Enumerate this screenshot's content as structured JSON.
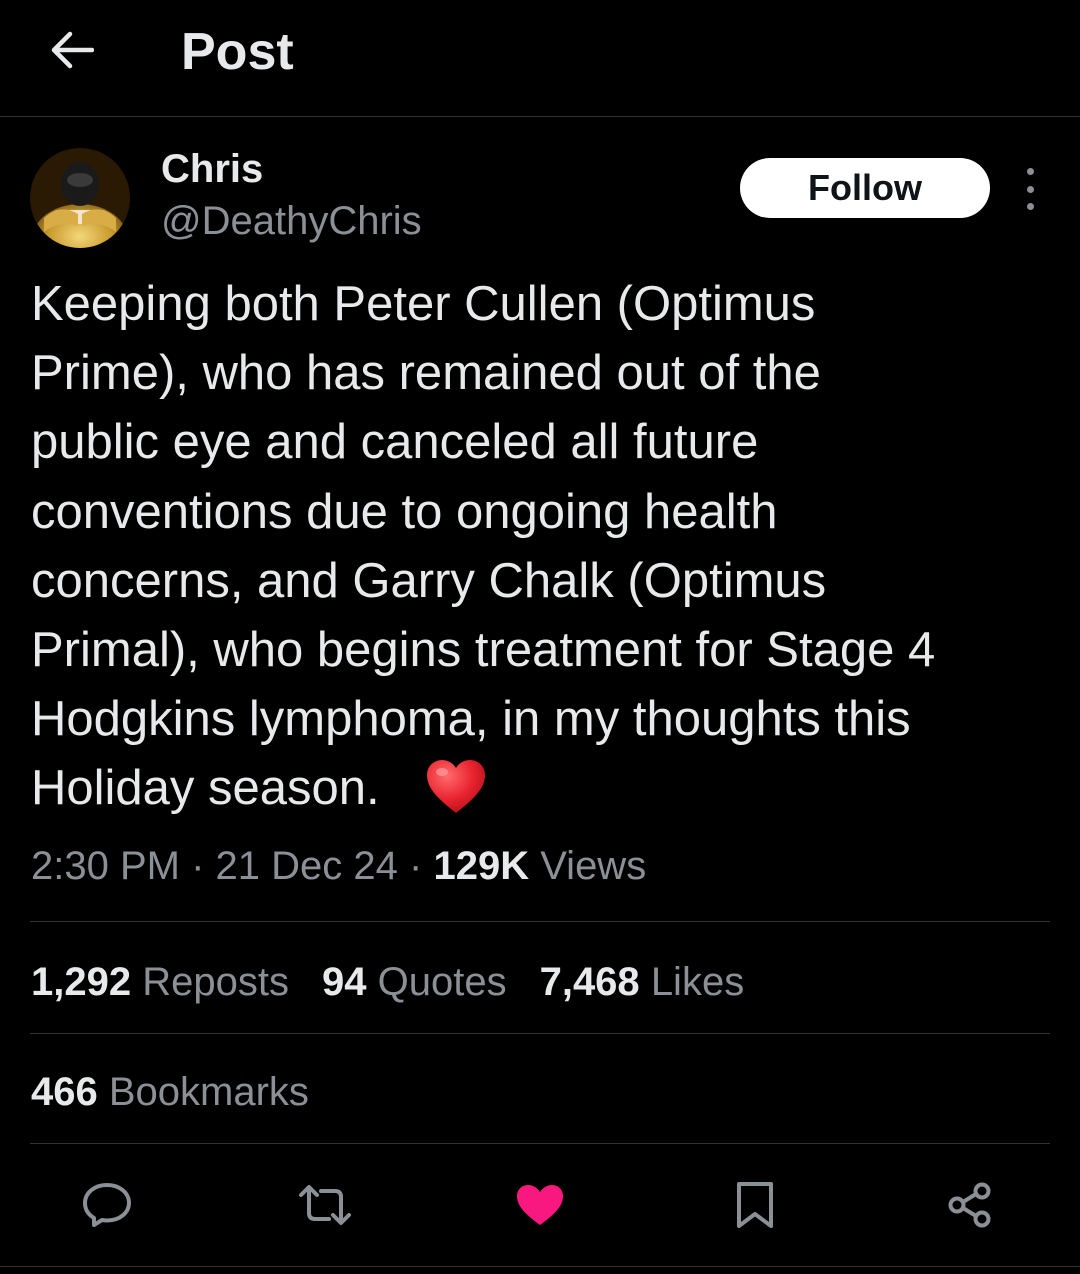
{
  "header": {
    "title": "Post",
    "back_icon": "arrow-left-icon"
  },
  "author": {
    "display_name": "Chris",
    "handle": "@DeathyChris",
    "avatar": "gold-ranger-avatar"
  },
  "follow_button": {
    "label": "Follow"
  },
  "more_icon": "more-vertical-icon",
  "tweet": {
    "text": "Keeping both Peter Cullen (Optimus\nPrime), who has remained out of the\npublic eye and canceled all future\nconventions due to ongoing health\nconcerns, and Garry Chalk (Optimus\nPrimal), who begins treatment for Stage 4\nHodgkins lymphoma, in my thoughts this\nHoliday season.",
    "emoji": "red-heart-emoji"
  },
  "meta": {
    "time": "2:30 PM",
    "separator": "·",
    "date": "21 Dec 24",
    "views_count": "129K",
    "views_label": "Views"
  },
  "stats": [
    {
      "count": "1,292",
      "label": "Reposts"
    },
    {
      "count": "94",
      "label": "Quotes"
    },
    {
      "count": "7,468",
      "label": "Likes"
    }
  ],
  "bookmarks": {
    "count": "466",
    "label": "Bookmarks"
  },
  "actions": {
    "reply_icon": "reply-icon",
    "repost_icon": "repost-icon",
    "like_icon": "heart-icon",
    "like_active": true,
    "like_color": "#f91880",
    "bookmark_icon": "bookmark-icon",
    "share_icon": "share-icon"
  },
  "colors": {
    "background": "#000000",
    "text_primary": "#e7e9ea",
    "text_secondary": "#8b9096",
    "divider": "#2f3336"
  }
}
